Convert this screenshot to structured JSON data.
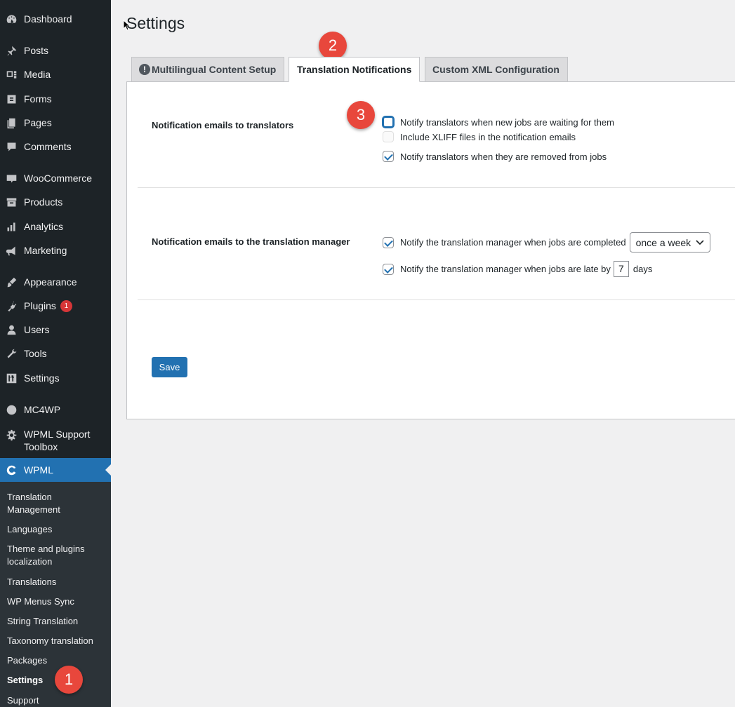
{
  "sidebar": {
    "items": [
      {
        "label": "Dashboard",
        "icon": "dashboard-icon"
      },
      {
        "label": "Posts",
        "icon": "pin-icon"
      },
      {
        "label": "Media",
        "icon": "media-icon"
      },
      {
        "label": "Forms",
        "icon": "forms-icon"
      },
      {
        "label": "Pages",
        "icon": "pages-icon"
      },
      {
        "label": "Comments",
        "icon": "comments-icon"
      },
      {
        "label": "WooCommerce",
        "icon": "woocommerce-icon"
      },
      {
        "label": "Products",
        "icon": "archive-icon"
      },
      {
        "label": "Analytics",
        "icon": "bar-chart-icon"
      },
      {
        "label": "Marketing",
        "icon": "megaphone-icon"
      },
      {
        "label": "Appearance",
        "icon": "brush-icon"
      },
      {
        "label": "Plugins",
        "icon": "plugin-icon",
        "badge": "1"
      },
      {
        "label": "Users",
        "icon": "user-icon"
      },
      {
        "label": "Tools",
        "icon": "wrench-icon"
      },
      {
        "label": "Settings",
        "icon": "sliders-icon"
      },
      {
        "label": "MC4WP",
        "icon": "mc4wp-icon"
      },
      {
        "label": "WPML Support Toolbox",
        "icon": "gear-icon"
      },
      {
        "label": "WPML",
        "icon": "wpml-icon",
        "active": true
      }
    ],
    "submenu": [
      "Translation Management",
      "Languages",
      "Theme and plugins localization",
      "Translations",
      "WP Menus Sync",
      "String Translation",
      "Taxonomy translation",
      "Packages",
      "Settings",
      "Support"
    ],
    "submenu_current": "Settings"
  },
  "page": {
    "title": "Settings",
    "tabs": [
      {
        "label": "Multilingual Content Setup",
        "icon": "warning-icon"
      },
      {
        "label": "Translation Notifications",
        "active": true
      },
      {
        "label": "Custom XML Configuration"
      }
    ]
  },
  "sections": {
    "translators": {
      "label": "Notification emails to translators",
      "options": [
        {
          "label": "Notify translators when new jobs are waiting for them",
          "checked": false
        },
        {
          "label": "Include XLIFF files in the notification emails",
          "checked": false,
          "disabled": true
        },
        {
          "label": "Notify translators when they are removed from jobs",
          "checked": true
        }
      ]
    },
    "manager": {
      "label": "Notification emails to the translation manager",
      "completed_label": "Notify the translation manager when jobs are completed",
      "frequency": "once a week",
      "late_label": "Notify the translation manager when jobs are late by",
      "late_days": "7",
      "days_label": "days"
    }
  },
  "save_label": "Save",
  "steps": [
    "1",
    "2",
    "3"
  ],
  "colors": {
    "accent": "#2271b1",
    "step": "#e8473c",
    "sidebar": "#1d2327",
    "submenu": "#2c3338"
  }
}
